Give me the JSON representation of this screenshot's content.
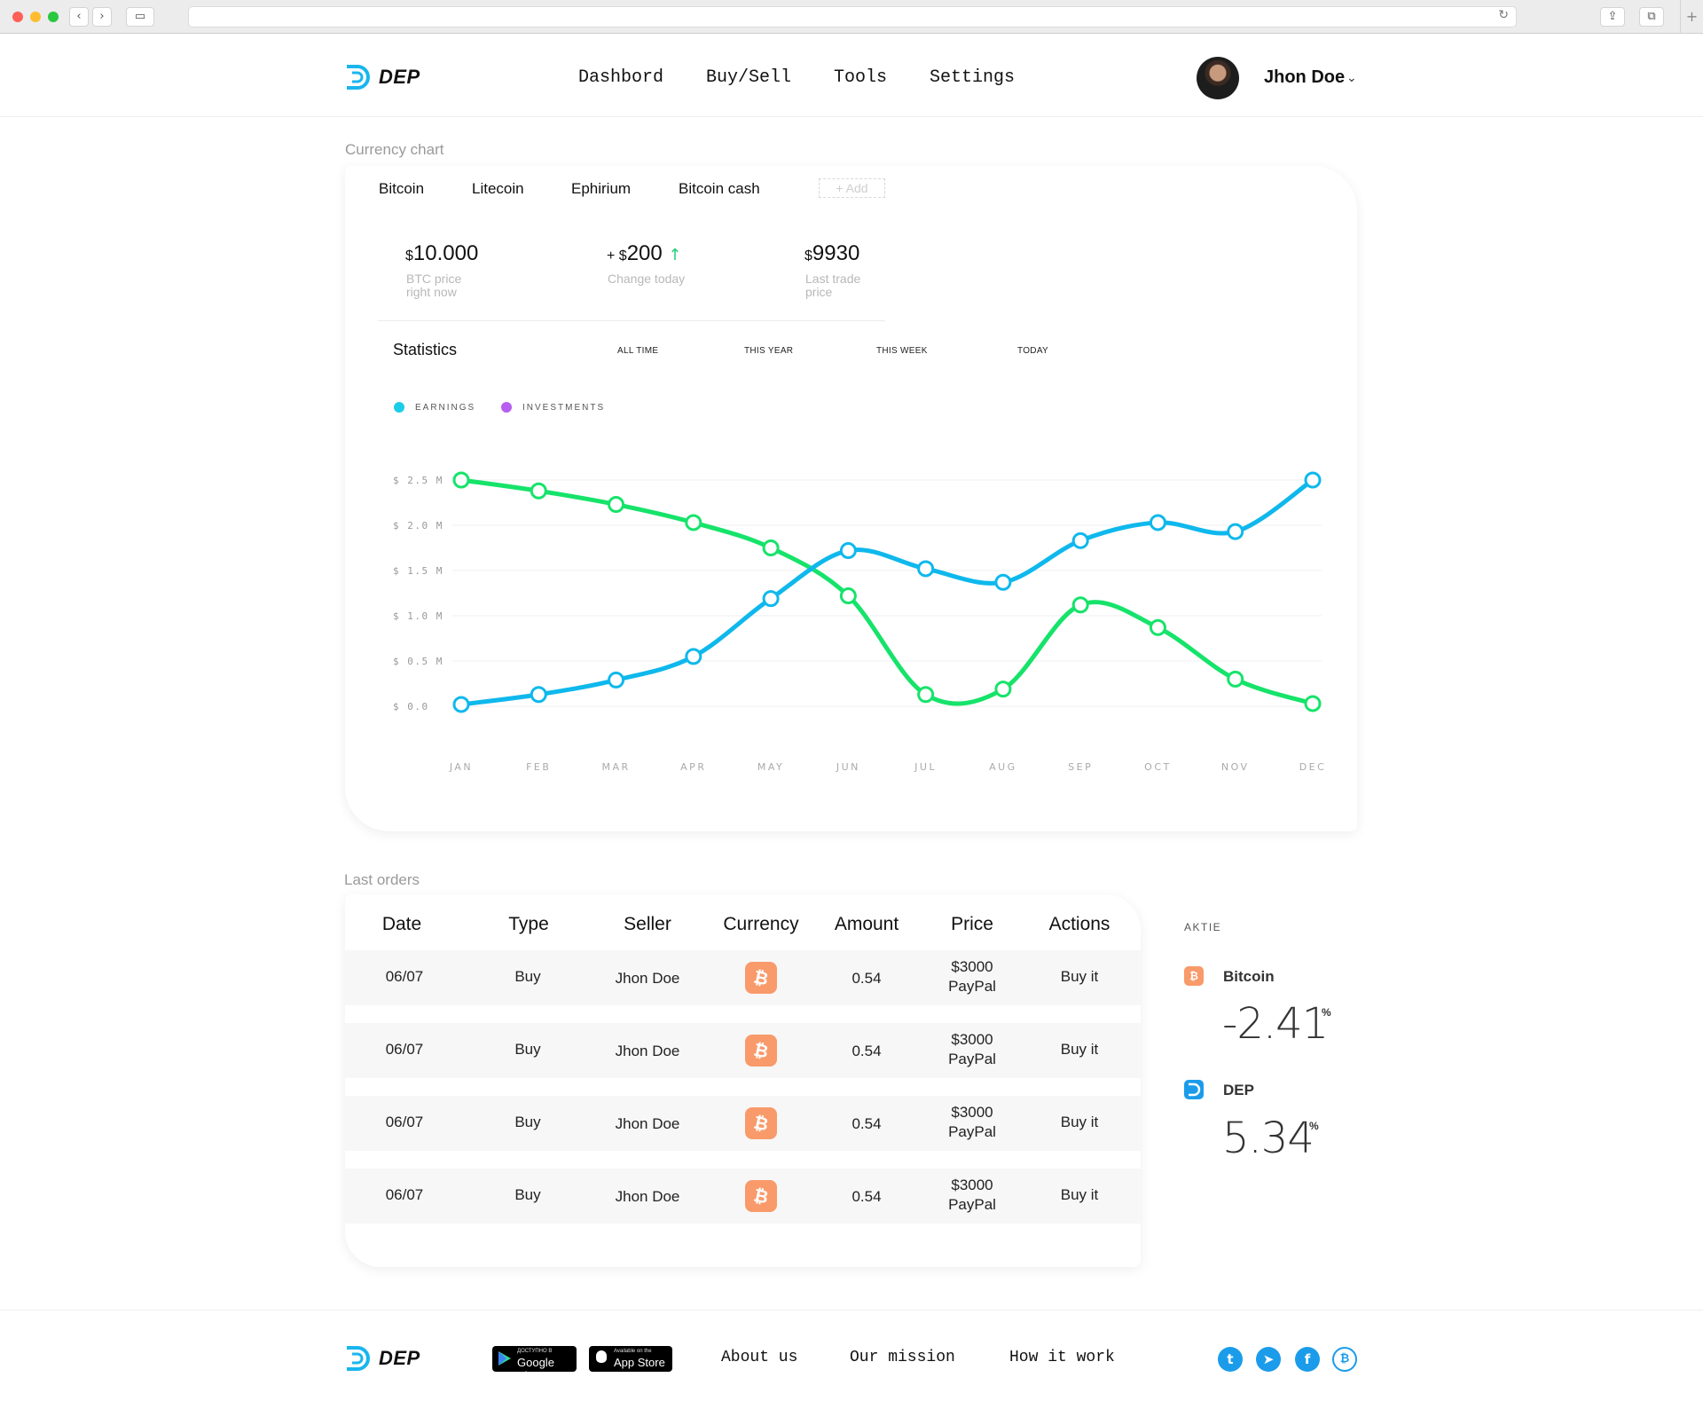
{
  "brand": {
    "name": "DEP"
  },
  "nav": [
    "Dashbord",
    "Buy/Sell",
    "Tools",
    "Settings"
  ],
  "user": {
    "name": "Jhon Doe"
  },
  "currency_chart": {
    "section_title": "Currency chart",
    "tabs": [
      "Bitcoin",
      "Litecoin",
      "Ephirium",
      "Bitcoin cash"
    ],
    "add_label": "+ Add",
    "stats": [
      {
        "prefix": "$",
        "value": "10.000",
        "label": "BTC price right now"
      },
      {
        "prefix": "+ $",
        "value": "200",
        "label": "Change today",
        "trend": "up"
      },
      {
        "prefix": "$",
        "value": "9930",
        "label": "Last trade price"
      }
    ],
    "statistics_title": "Statistics",
    "periods": [
      "ALL TIME",
      "THIS YEAR",
      "THIS WEEK",
      "TODAY"
    ],
    "legend": [
      {
        "label": "EARNINGS",
        "color": "#1ccde8"
      },
      {
        "label": "INVESTMENTS",
        "color": "#b75ef0"
      }
    ]
  },
  "chart_data": {
    "type": "line",
    "categories": [
      "JAN",
      "FEB",
      "MAR",
      "APR",
      "MAY",
      "JUN",
      "JUL",
      "AUG",
      "SEP",
      "OCT",
      "NOV",
      "DEC"
    ],
    "y_ticks": [
      "$ 2.5 M",
      "$ 2.0 M",
      "$ 1.5 M",
      "$ 1.0 M",
      "$ 0.5 M",
      "$ 0.0"
    ],
    "ylim": [
      0,
      2.5
    ],
    "grid": true,
    "series": [
      {
        "color": "#16e36a",
        "values": [
          2.5,
          2.38,
          2.23,
          2.03,
          1.75,
          1.22,
          0.13,
          0.19,
          1.12,
          0.87,
          0.3,
          0.03
        ]
      },
      {
        "color": "#0fb8ec",
        "values": [
          0.02,
          0.13,
          0.29,
          0.55,
          1.19,
          1.72,
          1.52,
          1.37,
          1.83,
          2.03,
          1.93,
          2.5
        ]
      }
    ]
  },
  "orders": {
    "section_title": "Last orders",
    "columns": [
      "Date",
      "Type",
      "Seller",
      "Currency",
      "Amount",
      "Price",
      "Actions"
    ],
    "rows": [
      {
        "date": "06/07",
        "type": "Buy",
        "seller": "Jhon Doe",
        "currency": "bitcoin-icon",
        "amount": "0.54",
        "price": "$3000",
        "method": "PayPal",
        "action": "Buy it"
      },
      {
        "date": "06/07",
        "type": "Buy",
        "seller": "Jhon Doe",
        "currency": "bitcoin-icon",
        "amount": "0.54",
        "price": "$3000",
        "method": "PayPal",
        "action": "Buy it"
      },
      {
        "date": "06/07",
        "type": "Buy",
        "seller": "Jhon Doe",
        "currency": "bitcoin-icon",
        "amount": "0.54",
        "price": "$3000",
        "method": "PayPal",
        "action": "Buy it"
      },
      {
        "date": "06/07",
        "type": "Buy",
        "seller": "Jhon Doe",
        "currency": "bitcoin-icon",
        "amount": "0.54",
        "price": "$3000",
        "method": "PayPal",
        "action": "Buy it"
      }
    ]
  },
  "aktie": {
    "title": "AKTIE",
    "items": [
      {
        "name": "Bitcoin",
        "value": "-2.41",
        "unit": "%",
        "color": "#f99a6b"
      },
      {
        "name": "DEP",
        "value": "5.34",
        "unit": "%",
        "color": "#1b9cea"
      }
    ]
  },
  "footer": {
    "stores": [
      {
        "small": "ДОСТУПНО В",
        "big": "Google Play"
      },
      {
        "small": "Available on the",
        "big": "App Store"
      }
    ],
    "links": [
      "About us",
      "Our mission",
      "How it work"
    ],
    "social": [
      "twitter-icon",
      "telegram-icon",
      "facebook-icon",
      "bitcoin-icon"
    ]
  }
}
